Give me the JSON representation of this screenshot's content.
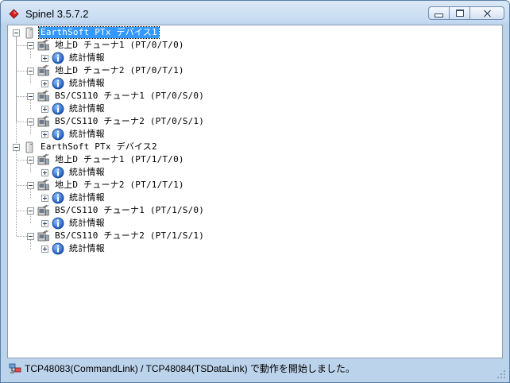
{
  "window": {
    "title": "Spinel 3.5.7.2"
  },
  "tree": {
    "devices": [
      {
        "label": "EarthSoft PTx デバイス1",
        "selected": true,
        "tuners": [
          {
            "label": "地上D チューナ1 (PT/0/T/0)",
            "child": "統計情報"
          },
          {
            "label": "地上D チューナ2 (PT/0/T/1)",
            "child": "統計情報"
          },
          {
            "label": "BS/CS110 チューナ1 (PT/0/S/0)",
            "child": "統計情報"
          },
          {
            "label": "BS/CS110 チューナ2 (PT/0/S/1)",
            "child": "統計情報"
          }
        ]
      },
      {
        "label": "EarthSoft PTx デバイス2",
        "selected": false,
        "tuners": [
          {
            "label": "地上D チューナ1 (PT/1/T/0)",
            "child": "統計情報"
          },
          {
            "label": "地上D チューナ2 (PT/1/T/1)",
            "child": "統計情報"
          },
          {
            "label": "BS/CS110 チューナ1 (PT/1/S/0)",
            "child": "統計情報"
          },
          {
            "label": "BS/CS110 チューナ2 (PT/1/S/1)",
            "child": "統計情報"
          }
        ]
      }
    ]
  },
  "status": {
    "text": "TCP48083(CommandLink) / TCP48084(TSDataLink) で動作を開始しました。"
  },
  "icons": {
    "app": "spinel-app-icon",
    "device": "device-icon",
    "tuner": "tuner-icon",
    "stats": "info-icon",
    "status": "network-icon"
  }
}
